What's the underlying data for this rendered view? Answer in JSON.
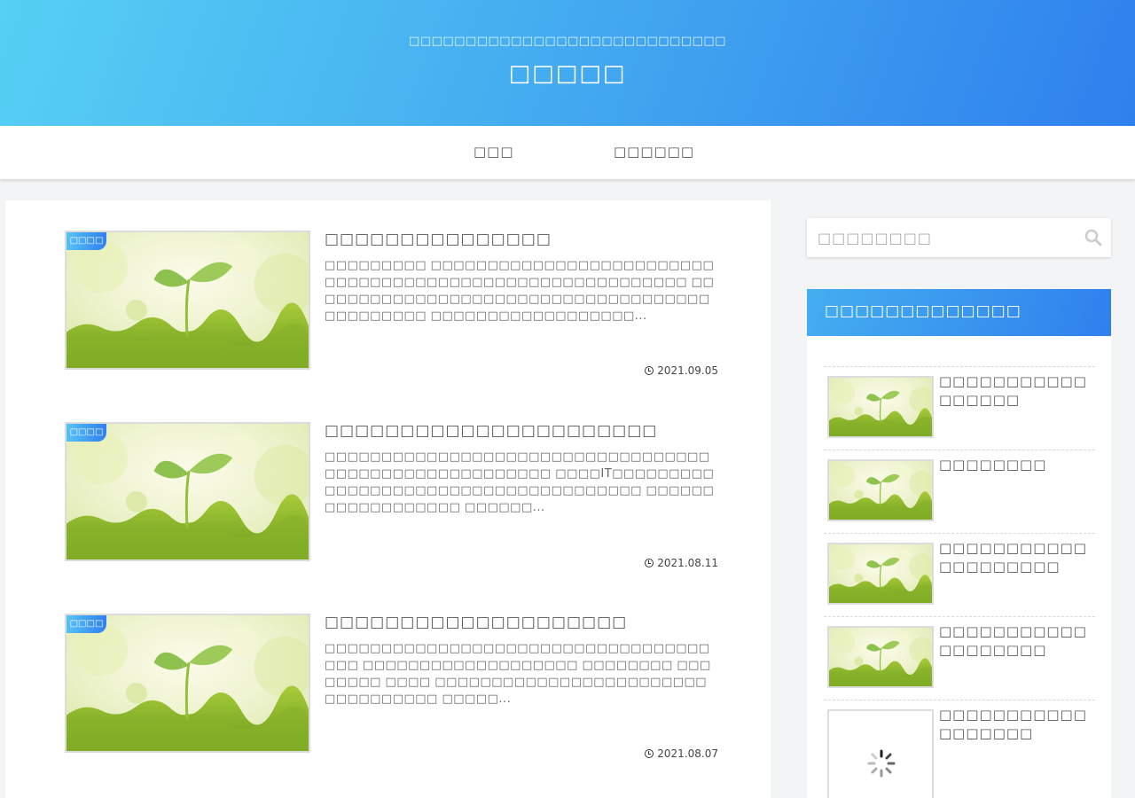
{
  "header": {
    "tagline": "□□□□□□□□□□□□□□□□□□□□□□□□□□□□",
    "site_title": "□□□□□"
  },
  "nav": {
    "items": [
      {
        "label": "□□□"
      },
      {
        "label": "□□□□□□"
      }
    ]
  },
  "posts": [
    {
      "category": "□□□□",
      "title": "□□□□□□□□□□□□□□□",
      "excerpt": "□□□□□□□□□ □□□□□□□□□□□□□□□□□□□□□□□□□□□□□□□□□□□□□□□□□□□□□□□□□□□□□□□□□ □□□□□□□□□□□□□□□□□□□□□□□□□□□□□□□□□□□□□□□□□□□□□ □□□□□□□□□□□□□□□□□□...",
      "date": "2021.09.05"
    },
    {
      "category": "□□□□",
      "title": "□□□□□□□□□□□□□□□□□□□□□□",
      "excerpt": "□□□□□□□□□□□□□□□□□□□□□□□□□□□□□□□□□□□□□□□□□□□□□□□□□□□□□□ □□□□IT□□□□□□□□□□□□□□□□□□□□□□□□□□□□□□□□□□□□□ □□□□□□□□□□□□□□□□□□ □□□□□□...",
      "date": "2021.08.11"
    },
    {
      "category": "□□□□",
      "title": "□□□□□□□□□□□□□□□□□□□□",
      "excerpt": "□□□□□□□□□□□□□□□□□□□□□□□□□□□□□□□□□□□□□ □□□□□□□□□□□□□□□□□□□ □□□□□□□□ □□□□□□□□ □□□□ □□□□□□□□□□□□□□□□□□□□□□□□□□□□□□□□□□ □□□□□...",
      "date": "2021.08.07"
    }
  ],
  "search": {
    "placeholder": "□□□□□□□□"
  },
  "sidebar_widget": {
    "title": "□□□□□□□□□□□□□",
    "items": [
      {
        "title": "□□□□□□□□□□□□□□□□□"
      },
      {
        "title": "□□□□□□□□"
      },
      {
        "title": "□□□□□□□□□□□□□□□□□□□□"
      },
      {
        "title": "□□□□□□□□□□□□□□□□□□□"
      },
      {
        "title": "□□□□□□□□□□□□□□□□□□"
      }
    ]
  },
  "colors": {
    "header_gradient_start": "#56d0f4",
    "header_gradient_end": "#2f80ed",
    "widget_header": "#2f80ed",
    "page_background": "#f3f4f5"
  }
}
